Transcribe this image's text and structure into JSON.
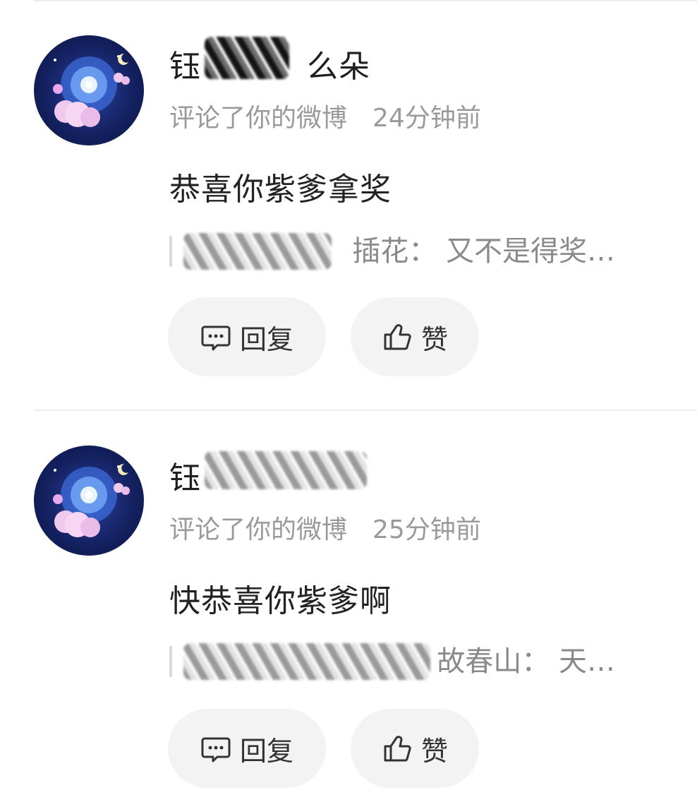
{
  "notifications": [
    {
      "username_visible": "钰",
      "username_tail": "么朵",
      "action": "评论了你的微博",
      "time": "24分钟前",
      "comment": "恭喜你紫爹拿奖",
      "quote_tail": "插花： 又不是得奖…",
      "reply_label": "回复",
      "like_label": "赞"
    },
    {
      "username_visible": "钰",
      "username_tail": "",
      "action": "评论了你的微博",
      "time": "25分钟前",
      "comment": "快恭喜你紫爹啊",
      "quote_tail": "故春山： 天…",
      "reply_label": "回复",
      "like_label": "赞"
    }
  ],
  "icons": {
    "reply": "comment-bubble-icon",
    "like": "thumbs-up-icon"
  },
  "colors": {
    "meta_text": "#9a9a9a",
    "button_bg": "#f3f3f3",
    "text": "#222222"
  }
}
